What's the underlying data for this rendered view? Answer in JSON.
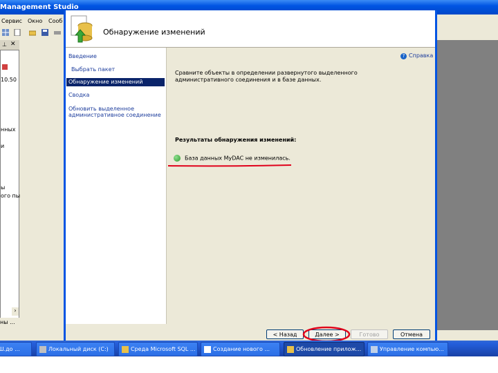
{
  "background_app": {
    "title": "Management Studio",
    "menu": [
      "Сервис",
      "Окно",
      "Сооб"
    ],
    "tree_items": [
      "10.50",
      "нных",
      "и",
      "ы",
      "ого пы"
    ],
    "status_text": "ны ..."
  },
  "dialog": {
    "title": "Обнаружение изменений",
    "nav": [
      {
        "label": "Введение"
      },
      {
        "label": "Выбрать пакет"
      },
      {
        "label": "Обнаружение изменений",
        "selected": true
      },
      {
        "label": "Сводка"
      },
      {
        "label": "Обновить выделенное"
      },
      {
        "label": "административное соединение"
      }
    ],
    "help_label": "Справка",
    "instructions_line1": "Сравните объекты в определении развернутого выделенного",
    "instructions_line2": "административного соединения и в базе данных.",
    "results_title": "Результаты обнаружения изменений:",
    "result_message": "База данных МуDAC не изменилась.",
    "buttons": {
      "back": "< Назад",
      "next": "Далее >",
      "finish": "Готово",
      "cancel": "Отмена"
    }
  },
  "taskbar": {
    "items": [
      {
        "label": "Ш.до ..."
      },
      {
        "label": "Локальный диск (C:)"
      },
      {
        "label": "Среда Microsoft SQL ..."
      },
      {
        "label": "Создание нового ..."
      },
      {
        "label": "Обновление прилож...",
        "active": true
      },
      {
        "label": "Управление компью..."
      }
    ]
  },
  "colors": {
    "accent_red": "#e0001a",
    "selection": "#0a246a",
    "xp_blue": "#0054e3"
  }
}
